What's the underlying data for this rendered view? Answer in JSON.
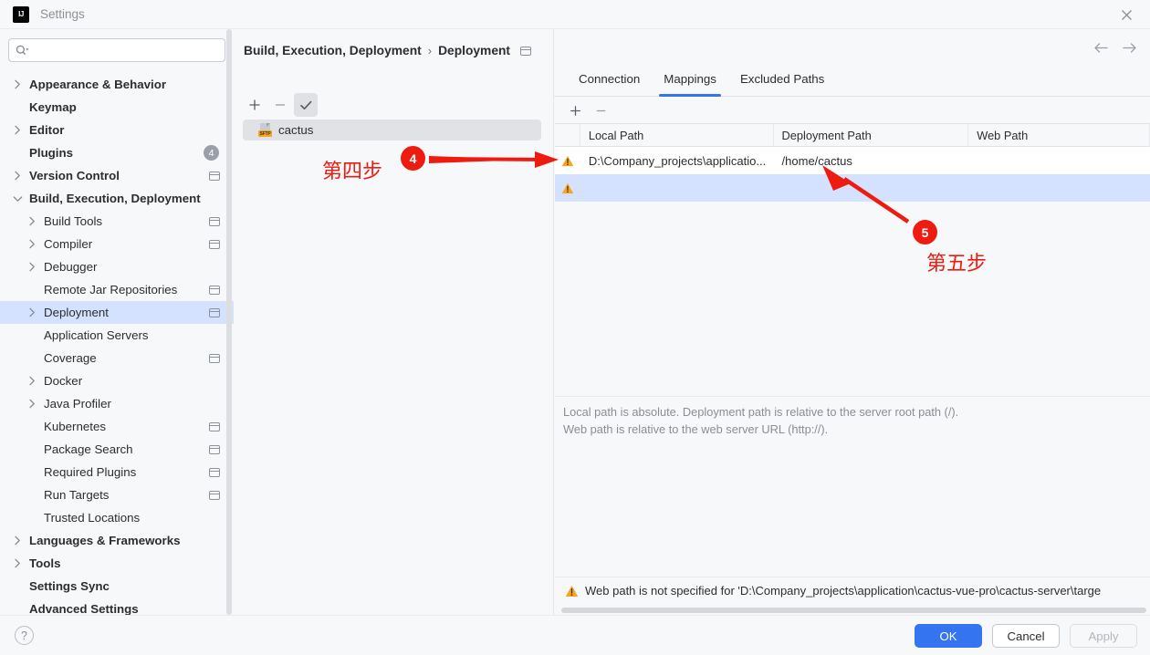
{
  "window": {
    "title": "Settings",
    "logo_text": "IJ",
    "close_icon": "close-icon"
  },
  "search": {
    "value": "",
    "placeholder": ""
  },
  "sidebar": {
    "items": [
      {
        "label": "Appearance & Behavior",
        "indent": 0,
        "chevron": "right",
        "bold": true,
        "badge": "",
        "project_icon": false,
        "selected": false
      },
      {
        "label": "Keymap",
        "indent": 0,
        "chevron": "none",
        "bold": true,
        "badge": "",
        "project_icon": false,
        "selected": false
      },
      {
        "label": "Editor",
        "indent": 0,
        "chevron": "right",
        "bold": true,
        "badge": "",
        "project_icon": false,
        "selected": false
      },
      {
        "label": "Plugins",
        "indent": 0,
        "chevron": "none",
        "bold": true,
        "badge": "4",
        "project_icon": false,
        "selected": false
      },
      {
        "label": "Version Control",
        "indent": 0,
        "chevron": "right",
        "bold": true,
        "badge": "",
        "project_icon": true,
        "selected": false
      },
      {
        "label": "Build, Execution, Deployment",
        "indent": 0,
        "chevron": "down",
        "bold": true,
        "badge": "",
        "project_icon": false,
        "selected": false
      },
      {
        "label": "Build Tools",
        "indent": 1,
        "chevron": "right",
        "bold": false,
        "badge": "",
        "project_icon": true,
        "selected": false
      },
      {
        "label": "Compiler",
        "indent": 1,
        "chevron": "right",
        "bold": false,
        "badge": "",
        "project_icon": true,
        "selected": false
      },
      {
        "label": "Debugger",
        "indent": 1,
        "chevron": "right",
        "bold": false,
        "badge": "",
        "project_icon": false,
        "selected": false
      },
      {
        "label": "Remote Jar Repositories",
        "indent": 1,
        "chevron": "none",
        "bold": false,
        "badge": "",
        "project_icon": true,
        "selected": false
      },
      {
        "label": "Deployment",
        "indent": 1,
        "chevron": "right",
        "bold": false,
        "badge": "",
        "project_icon": true,
        "selected": true
      },
      {
        "label": "Application Servers",
        "indent": 1,
        "chevron": "none",
        "bold": false,
        "badge": "",
        "project_icon": false,
        "selected": false
      },
      {
        "label": "Coverage",
        "indent": 1,
        "chevron": "none",
        "bold": false,
        "badge": "",
        "project_icon": true,
        "selected": false
      },
      {
        "label": "Docker",
        "indent": 1,
        "chevron": "right",
        "bold": false,
        "badge": "",
        "project_icon": false,
        "selected": false
      },
      {
        "label": "Java Profiler",
        "indent": 1,
        "chevron": "right",
        "bold": false,
        "badge": "",
        "project_icon": false,
        "selected": false
      },
      {
        "label": "Kubernetes",
        "indent": 1,
        "chevron": "none",
        "bold": false,
        "badge": "",
        "project_icon": true,
        "selected": false
      },
      {
        "label": "Package Search",
        "indent": 1,
        "chevron": "none",
        "bold": false,
        "badge": "",
        "project_icon": true,
        "selected": false
      },
      {
        "label": "Required Plugins",
        "indent": 1,
        "chevron": "none",
        "bold": false,
        "badge": "",
        "project_icon": true,
        "selected": false
      },
      {
        "label": "Run Targets",
        "indent": 1,
        "chevron": "none",
        "bold": false,
        "badge": "",
        "project_icon": true,
        "selected": false
      },
      {
        "label": "Trusted Locations",
        "indent": 1,
        "chevron": "none",
        "bold": false,
        "badge": "",
        "project_icon": false,
        "selected": false
      },
      {
        "label": "Languages & Frameworks",
        "indent": 0,
        "chevron": "right",
        "bold": true,
        "badge": "",
        "project_icon": false,
        "selected": false
      },
      {
        "label": "Tools",
        "indent": 0,
        "chevron": "right",
        "bold": true,
        "badge": "",
        "project_icon": false,
        "selected": false
      },
      {
        "label": "Settings Sync",
        "indent": 0,
        "chevron": "none",
        "bold": true,
        "badge": "",
        "project_icon": false,
        "selected": false
      },
      {
        "label": "Advanced Settings",
        "indent": 0,
        "chevron": "none",
        "bold": true,
        "badge": "",
        "project_icon": false,
        "selected": false
      }
    ]
  },
  "breadcrumb": {
    "root": "Build, Execution, Deployment",
    "separator": "›",
    "leaf": "Deployment"
  },
  "mid_toolbar": {
    "add": "+",
    "remove": "−",
    "set_default": "✓"
  },
  "servers": {
    "items": [
      {
        "name": "cactus",
        "icon": "sftp-server-icon",
        "badge": "SFTP",
        "selected": true
      }
    ]
  },
  "tabs": [
    {
      "label": "Connection",
      "active": false
    },
    {
      "label": "Mappings",
      "active": true
    },
    {
      "label": "Excluded Paths",
      "active": false
    }
  ],
  "mappings_toolbar": {
    "add": "+",
    "remove": "−"
  },
  "mappings_table": {
    "columns": [
      "Local Path",
      "Deployment Path",
      "Web Path"
    ],
    "rows": [
      {
        "status_icon": "warning-icon",
        "local_path": "D:\\Company_projects\\applicatio...",
        "deployment_path": "/home/cactus",
        "web_path": "",
        "selected": false
      },
      {
        "status_icon": "warning-icon",
        "local_path": "",
        "deployment_path": "",
        "web_path": "",
        "selected": true
      }
    ]
  },
  "hint": {
    "line1": "Local path is absolute. Deployment path is relative to the server root path (/).",
    "line2": "Web path is relative to the web server URL (http://)."
  },
  "warning_bar": {
    "icon": "warning-icon",
    "text": "Web path is not specified for 'D:\\Company_projects\\application\\cactus-vue-pro\\cactus-server\\targe"
  },
  "footer": {
    "help": "?",
    "ok": "OK",
    "cancel": "Cancel",
    "apply": "Apply"
  },
  "annotations": [
    {
      "number": "4",
      "text": "第四步"
    },
    {
      "number": "5",
      "text": "第五步"
    }
  ],
  "colors": {
    "accent": "#3574f0",
    "selection": "#d4e2ff",
    "annotation": "#ee1b11",
    "warning": "#f5a623"
  }
}
